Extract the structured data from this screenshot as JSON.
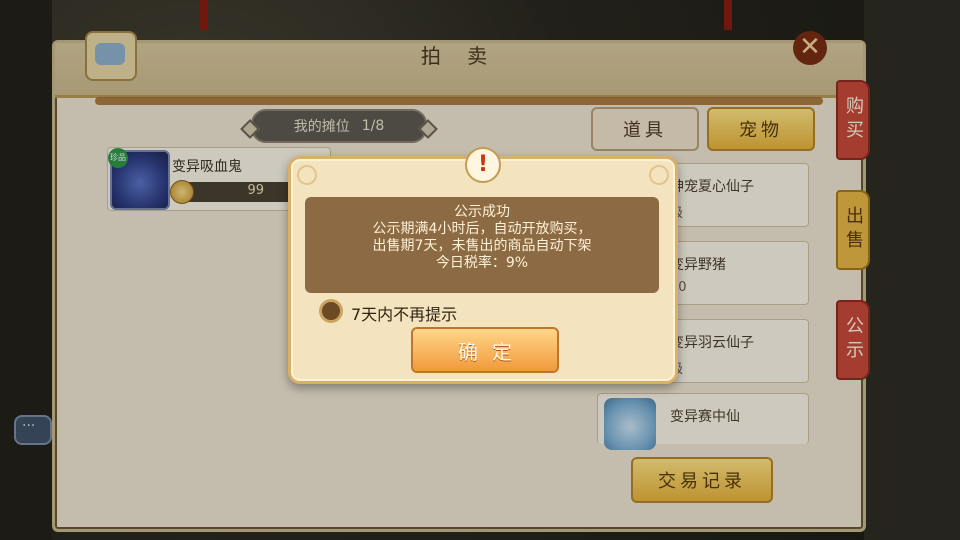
{
  "panel": {
    "title": "拍 卖",
    "close_icon": "✕"
  },
  "stall": {
    "label": "我的摊位",
    "count": "1/8"
  },
  "my_listing": {
    "name": "变异吸血鬼",
    "badge": "珍品",
    "price": "99"
  },
  "tabs": {
    "items": "道具",
    "pets": "宠物"
  },
  "list_rows": [
    {
      "name": "神宠夏心仙子",
      "sub": "级"
    },
    {
      "name": "变异野猪",
      "sub": "50"
    },
    {
      "name": "变异羽云仙子",
      "sub": "级"
    },
    {
      "name": "变异赛中仙",
      "sub": ""
    }
  ],
  "trade_record_button": "交易记录",
  "side_tabs": {
    "buy": "购买",
    "sell": "出售",
    "publicity": "公示"
  },
  "dialog": {
    "alert_icon": "!",
    "line1": "公示成功",
    "line2": "公示期满4小时后，自动开放购买，",
    "line3": "出售期7天，未售出的商品自动下架",
    "line4": "今日税率：9%",
    "checkbox_label": "7天内不再提示",
    "confirm_label": "确定"
  },
  "colors": {
    "accent_gold": "#e8b43c",
    "accent_red": "#c84a3a",
    "dialog_bg": "#f4e3bf",
    "message_bg": "#8c6b44"
  }
}
